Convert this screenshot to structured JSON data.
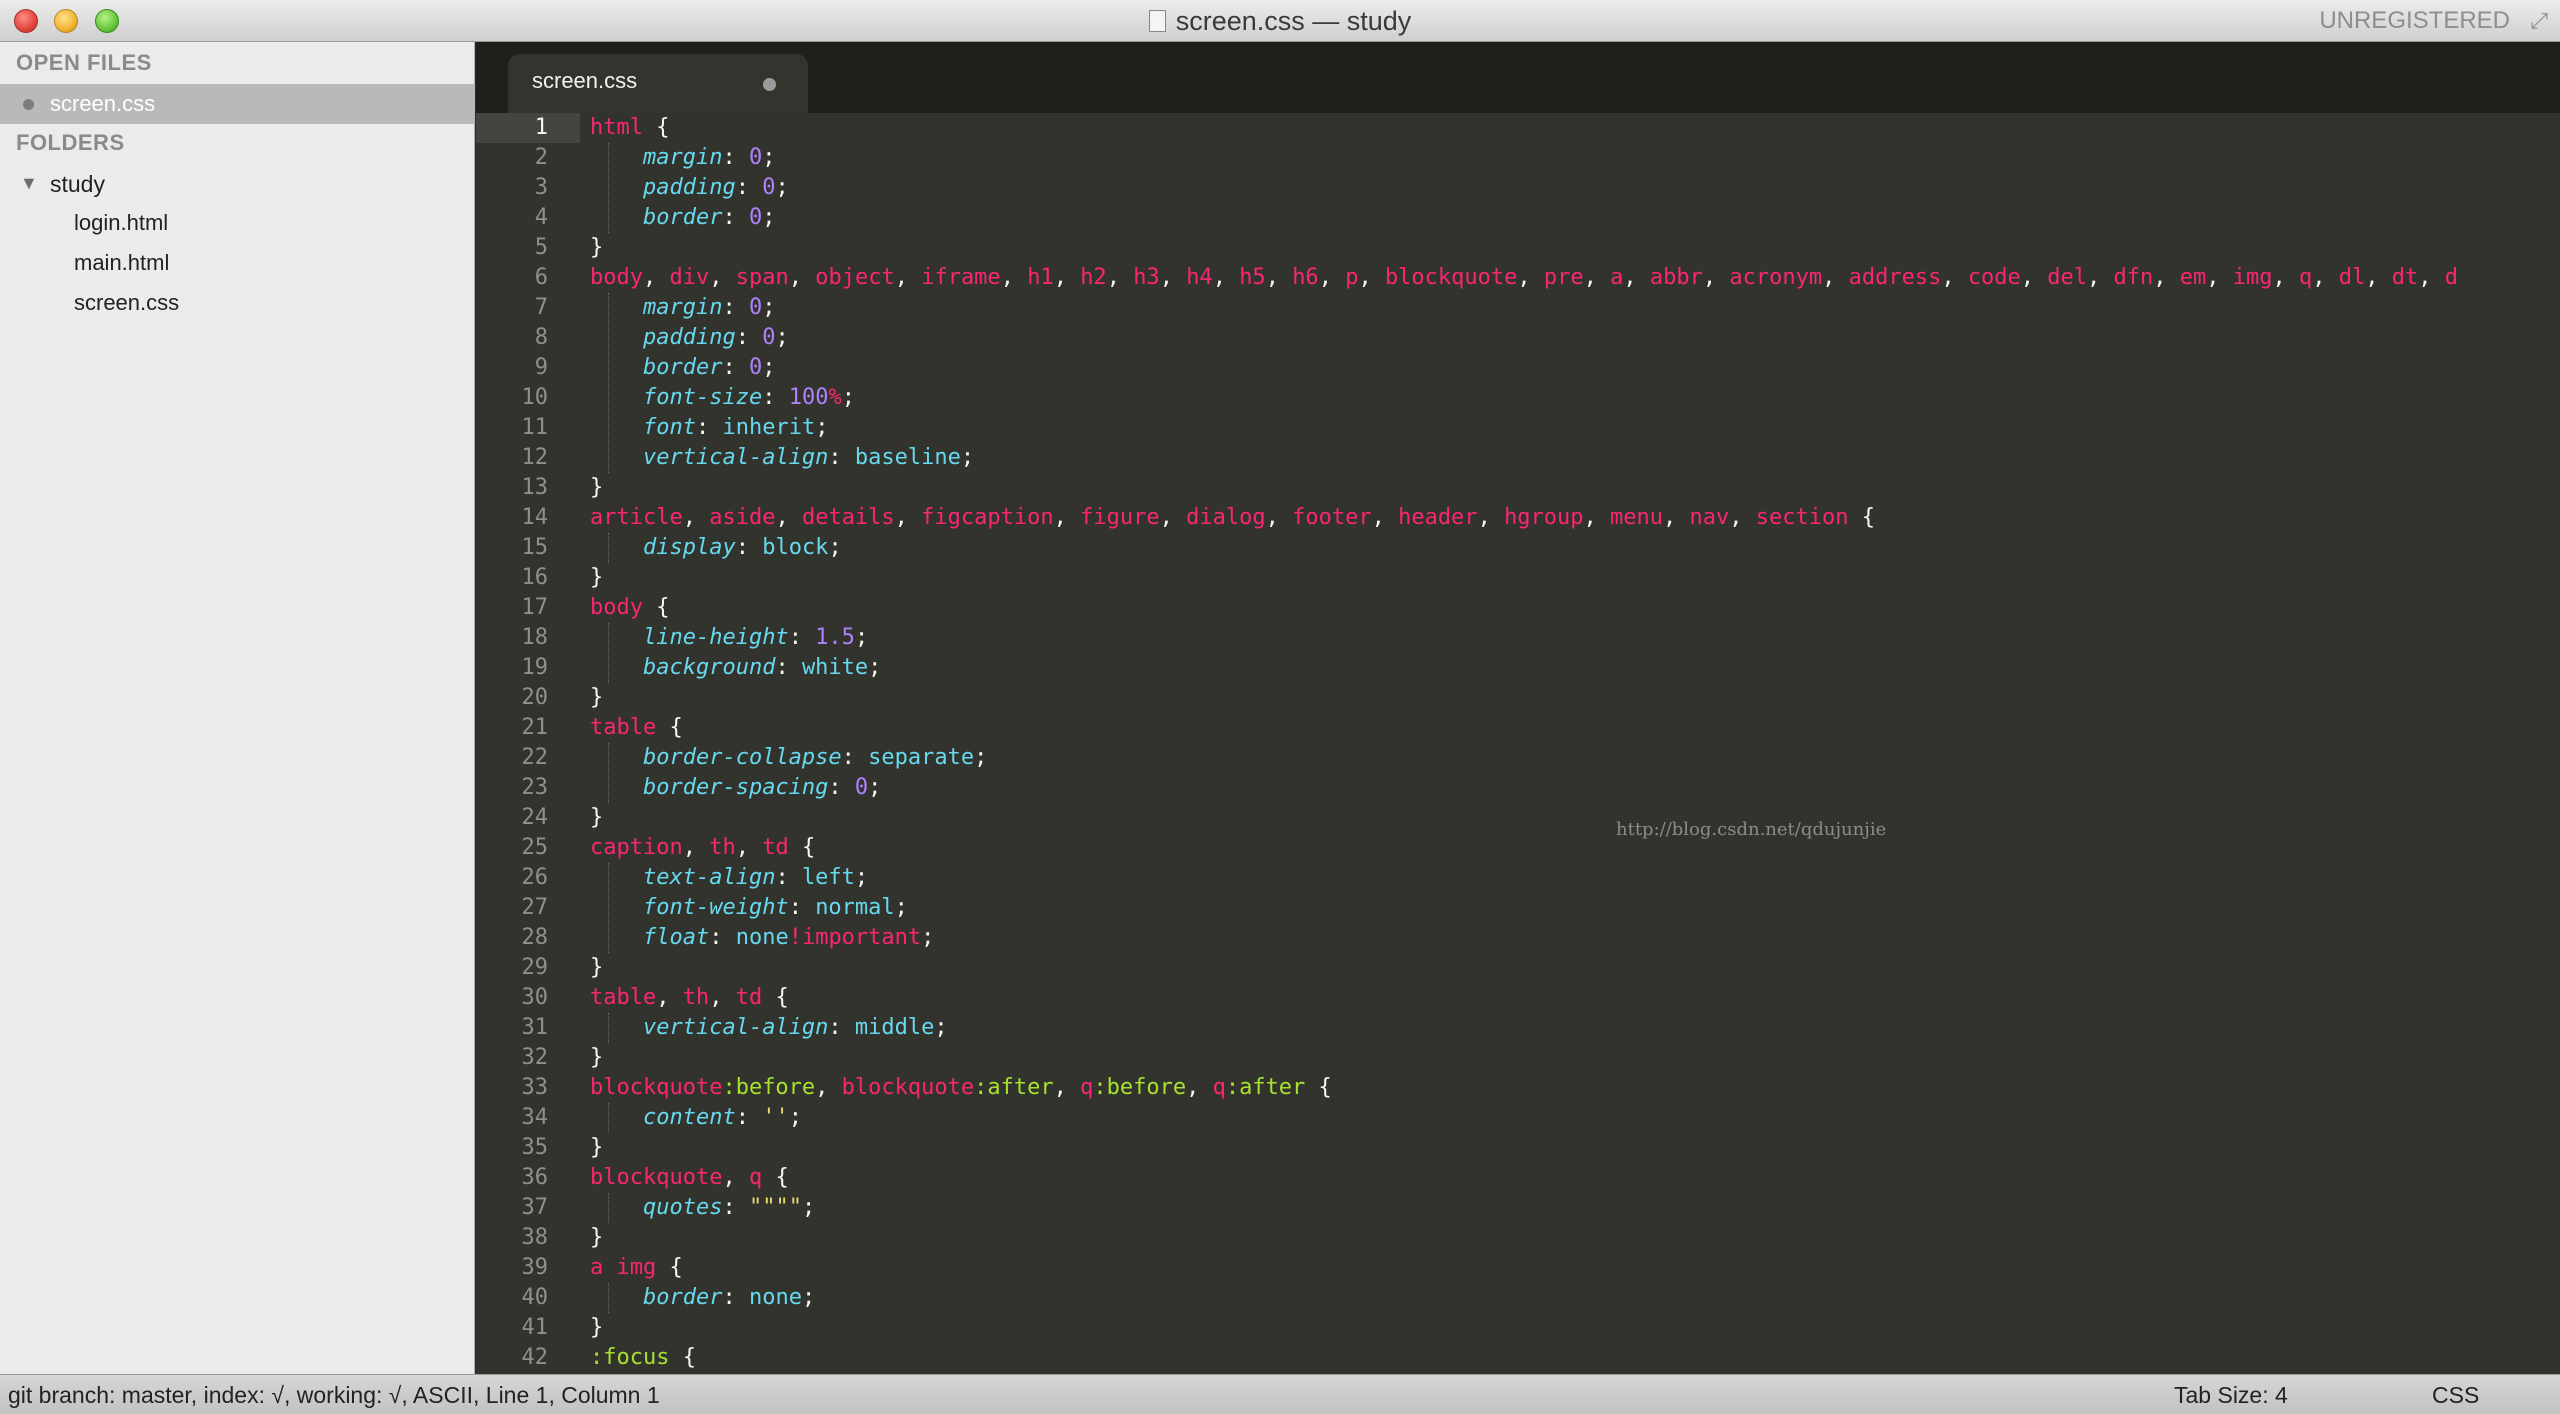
{
  "window": {
    "title": "screen.css — study",
    "registration": "UNREGISTERED"
  },
  "sidebar": {
    "open_files_header": "OPEN FILES",
    "open_files": [
      {
        "label": "screen.css"
      }
    ],
    "folders_header": "FOLDERS",
    "folder": {
      "label": "study",
      "expanded": true
    },
    "files": [
      {
        "label": "login.html"
      },
      {
        "label": "main.html"
      },
      {
        "label": "screen.css"
      }
    ]
  },
  "tabs": [
    {
      "label": "screen.css",
      "dirty": true,
      "active": true
    }
  ],
  "editor": {
    "current_line": 1,
    "watermark": "http://blog.csdn.net/qdujunjie",
    "lines": [
      [
        [
          "sel",
          "html"
        ],
        [
          "punc",
          " {"
        ]
      ],
      [
        [
          "ws",
          "    "
        ],
        [
          "prop",
          "margin"
        ],
        [
          "punc",
          ": "
        ],
        [
          "num",
          "0"
        ],
        [
          "punc",
          ";"
        ]
      ],
      [
        [
          "ws",
          "    "
        ],
        [
          "prop",
          "padding"
        ],
        [
          "punc",
          ": "
        ],
        [
          "num",
          "0"
        ],
        [
          "punc",
          ";"
        ]
      ],
      [
        [
          "ws",
          "    "
        ],
        [
          "prop",
          "border"
        ],
        [
          "punc",
          ": "
        ],
        [
          "num",
          "0"
        ],
        [
          "punc",
          ";"
        ]
      ],
      [
        [
          "punc",
          "}"
        ]
      ],
      [
        [
          "sel",
          "body"
        ],
        [
          "punc",
          ", "
        ],
        [
          "sel",
          "div"
        ],
        [
          "punc",
          ", "
        ],
        [
          "sel",
          "span"
        ],
        [
          "punc",
          ", "
        ],
        [
          "sel",
          "object"
        ],
        [
          "punc",
          ", "
        ],
        [
          "sel",
          "iframe"
        ],
        [
          "punc",
          ", "
        ],
        [
          "sel",
          "h1"
        ],
        [
          "punc",
          ", "
        ],
        [
          "sel",
          "h2"
        ],
        [
          "punc",
          ", "
        ],
        [
          "sel",
          "h3"
        ],
        [
          "punc",
          ", "
        ],
        [
          "sel",
          "h4"
        ],
        [
          "punc",
          ", "
        ],
        [
          "sel",
          "h5"
        ],
        [
          "punc",
          ", "
        ],
        [
          "sel",
          "h6"
        ],
        [
          "punc",
          ", "
        ],
        [
          "sel",
          "p"
        ],
        [
          "punc",
          ", "
        ],
        [
          "sel",
          "blockquote"
        ],
        [
          "punc",
          ", "
        ],
        [
          "sel",
          "pre"
        ],
        [
          "punc",
          ", "
        ],
        [
          "sel",
          "a"
        ],
        [
          "punc",
          ", "
        ],
        [
          "sel",
          "abbr"
        ],
        [
          "punc",
          ", "
        ],
        [
          "sel",
          "acronym"
        ],
        [
          "punc",
          ", "
        ],
        [
          "sel",
          "address"
        ],
        [
          "punc",
          ", "
        ],
        [
          "sel",
          "code"
        ],
        [
          "punc",
          ", "
        ],
        [
          "sel",
          "del"
        ],
        [
          "punc",
          ", "
        ],
        [
          "sel",
          "dfn"
        ],
        [
          "punc",
          ", "
        ],
        [
          "sel",
          "em"
        ],
        [
          "punc",
          ", "
        ],
        [
          "sel",
          "img"
        ],
        [
          "punc",
          ", "
        ],
        [
          "sel",
          "q"
        ],
        [
          "punc",
          ", "
        ],
        [
          "sel",
          "dl"
        ],
        [
          "punc",
          ", "
        ],
        [
          "sel",
          "dt"
        ],
        [
          "punc",
          ", "
        ],
        [
          "sel",
          "d"
        ]
      ],
      [
        [
          "ws",
          "    "
        ],
        [
          "prop",
          "margin"
        ],
        [
          "punc",
          ": "
        ],
        [
          "num",
          "0"
        ],
        [
          "punc",
          ";"
        ]
      ],
      [
        [
          "ws",
          "    "
        ],
        [
          "prop",
          "padding"
        ],
        [
          "punc",
          ": "
        ],
        [
          "num",
          "0"
        ],
        [
          "punc",
          ";"
        ]
      ],
      [
        [
          "ws",
          "    "
        ],
        [
          "prop",
          "border"
        ],
        [
          "punc",
          ": "
        ],
        [
          "num",
          "0"
        ],
        [
          "punc",
          ";"
        ]
      ],
      [
        [
          "ws",
          "    "
        ],
        [
          "prop",
          "font-size"
        ],
        [
          "punc",
          ": "
        ],
        [
          "num",
          "100"
        ],
        [
          "kw",
          "%"
        ],
        [
          "punc",
          ";"
        ]
      ],
      [
        [
          "ws",
          "    "
        ],
        [
          "prop",
          "font"
        ],
        [
          "punc",
          ": "
        ],
        [
          "val",
          "inherit"
        ],
        [
          "punc",
          ";"
        ]
      ],
      [
        [
          "ws",
          "    "
        ],
        [
          "prop",
          "vertical-align"
        ],
        [
          "punc",
          ": "
        ],
        [
          "val",
          "baseline"
        ],
        [
          "punc",
          ";"
        ]
      ],
      [
        [
          "punc",
          "}"
        ]
      ],
      [
        [
          "sel",
          "article"
        ],
        [
          "punc",
          ", "
        ],
        [
          "sel",
          "aside"
        ],
        [
          "punc",
          ", "
        ],
        [
          "sel",
          "details"
        ],
        [
          "punc",
          ", "
        ],
        [
          "sel",
          "figcaption"
        ],
        [
          "punc",
          ", "
        ],
        [
          "sel",
          "figure"
        ],
        [
          "punc",
          ", "
        ],
        [
          "sel",
          "dialog"
        ],
        [
          "punc",
          ", "
        ],
        [
          "sel",
          "footer"
        ],
        [
          "punc",
          ", "
        ],
        [
          "sel",
          "header"
        ],
        [
          "punc",
          ", "
        ],
        [
          "sel",
          "hgroup"
        ],
        [
          "punc",
          ", "
        ],
        [
          "sel",
          "menu"
        ],
        [
          "punc",
          ", "
        ],
        [
          "sel",
          "nav"
        ],
        [
          "punc",
          ", "
        ],
        [
          "sel",
          "section"
        ],
        [
          "punc",
          " {"
        ]
      ],
      [
        [
          "ws",
          "    "
        ],
        [
          "prop",
          "display"
        ],
        [
          "punc",
          ": "
        ],
        [
          "val",
          "block"
        ],
        [
          "punc",
          ";"
        ]
      ],
      [
        [
          "punc",
          "}"
        ]
      ],
      [
        [
          "sel",
          "body"
        ],
        [
          "punc",
          " {"
        ]
      ],
      [
        [
          "ws",
          "    "
        ],
        [
          "prop",
          "line-height"
        ],
        [
          "punc",
          ": "
        ],
        [
          "num",
          "1.5"
        ],
        [
          "punc",
          ";"
        ]
      ],
      [
        [
          "ws",
          "    "
        ],
        [
          "prop",
          "background"
        ],
        [
          "punc",
          ": "
        ],
        [
          "val",
          "white"
        ],
        [
          "punc",
          ";"
        ]
      ],
      [
        [
          "punc",
          "}"
        ]
      ],
      [
        [
          "sel",
          "table"
        ],
        [
          "punc",
          " {"
        ]
      ],
      [
        [
          "ws",
          "    "
        ],
        [
          "prop",
          "border-collapse"
        ],
        [
          "punc",
          ": "
        ],
        [
          "val",
          "separate"
        ],
        [
          "punc",
          ";"
        ]
      ],
      [
        [
          "ws",
          "    "
        ],
        [
          "prop",
          "border-spacing"
        ],
        [
          "punc",
          ": "
        ],
        [
          "num",
          "0"
        ],
        [
          "punc",
          ";"
        ]
      ],
      [
        [
          "punc",
          "}"
        ]
      ],
      [
        [
          "sel",
          "caption"
        ],
        [
          "punc",
          ", "
        ],
        [
          "sel",
          "th"
        ],
        [
          "punc",
          ", "
        ],
        [
          "sel",
          "td"
        ],
        [
          "punc",
          " {"
        ]
      ],
      [
        [
          "ws",
          "    "
        ],
        [
          "prop",
          "text-align"
        ],
        [
          "punc",
          ": "
        ],
        [
          "val",
          "left"
        ],
        [
          "punc",
          ";"
        ]
      ],
      [
        [
          "ws",
          "    "
        ],
        [
          "prop",
          "font-weight"
        ],
        [
          "punc",
          ": "
        ],
        [
          "val",
          "normal"
        ],
        [
          "punc",
          ";"
        ]
      ],
      [
        [
          "ws",
          "    "
        ],
        [
          "prop",
          "float"
        ],
        [
          "punc",
          ": "
        ],
        [
          "val",
          "none"
        ],
        [
          "kw",
          "!important"
        ],
        [
          "punc",
          ";"
        ]
      ],
      [
        [
          "punc",
          "}"
        ]
      ],
      [
        [
          "sel",
          "table"
        ],
        [
          "punc",
          ", "
        ],
        [
          "sel",
          "th"
        ],
        [
          "punc",
          ", "
        ],
        [
          "sel",
          "td"
        ],
        [
          "punc",
          " {"
        ]
      ],
      [
        [
          "ws",
          "    "
        ],
        [
          "prop",
          "vertical-align"
        ],
        [
          "punc",
          ": "
        ],
        [
          "val",
          "middle"
        ],
        [
          "punc",
          ";"
        ]
      ],
      [
        [
          "punc",
          "}"
        ]
      ],
      [
        [
          "sel",
          "blockquote"
        ],
        [
          "pseudo",
          ":before"
        ],
        [
          "punc",
          ", "
        ],
        [
          "sel",
          "blockquote"
        ],
        [
          "pseudo",
          ":after"
        ],
        [
          "punc",
          ", "
        ],
        [
          "sel",
          "q"
        ],
        [
          "pseudo",
          ":before"
        ],
        [
          "punc",
          ", "
        ],
        [
          "sel",
          "q"
        ],
        [
          "pseudo",
          ":after"
        ],
        [
          "punc",
          " {"
        ]
      ],
      [
        [
          "ws",
          "    "
        ],
        [
          "prop",
          "content"
        ],
        [
          "punc",
          ": "
        ],
        [
          "str",
          "''"
        ],
        [
          "punc",
          ";"
        ]
      ],
      [
        [
          "punc",
          "}"
        ]
      ],
      [
        [
          "sel",
          "blockquote"
        ],
        [
          "punc",
          ", "
        ],
        [
          "sel",
          "q"
        ],
        [
          "punc",
          " {"
        ]
      ],
      [
        [
          "ws",
          "    "
        ],
        [
          "prop",
          "quotes"
        ],
        [
          "punc",
          ": "
        ],
        [
          "str",
          "\"\"\"\""
        ],
        [
          "punc",
          ";"
        ]
      ],
      [
        [
          "punc",
          "}"
        ]
      ],
      [
        [
          "sel",
          "a"
        ],
        [
          "punc",
          " "
        ],
        [
          "sel",
          "img"
        ],
        [
          "punc",
          " {"
        ]
      ],
      [
        [
          "ws",
          "    "
        ],
        [
          "prop",
          "border"
        ],
        [
          "punc",
          ": "
        ],
        [
          "val",
          "none"
        ],
        [
          "punc",
          ";"
        ]
      ],
      [
        [
          "punc",
          "}"
        ]
      ],
      [
        [
          "pseudo",
          ":focus"
        ],
        [
          "punc",
          " {"
        ]
      ]
    ]
  },
  "statusbar": {
    "left": "git branch: master, index: √, working: √, ASCII, Line 1, Column 1",
    "tab_size": "Tab Size: 4",
    "syntax": "CSS"
  },
  "colors": {
    "selector": "#f92672",
    "property": "#66d9ef",
    "number": "#ae81ff",
    "string": "#e6db74",
    "pseudo": "#a6e22e",
    "background": "#33332e"
  }
}
